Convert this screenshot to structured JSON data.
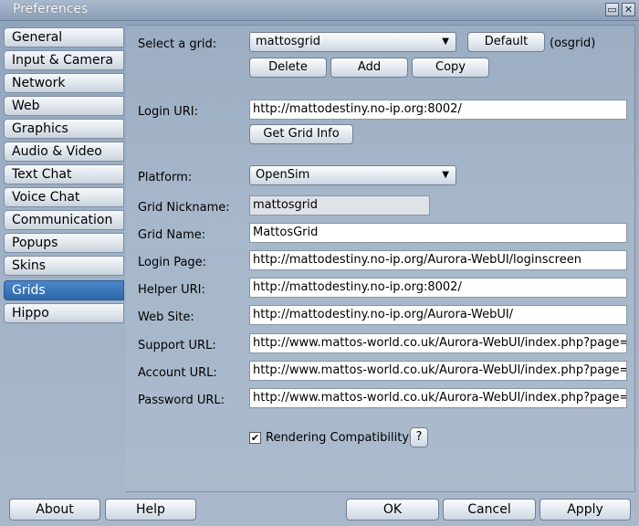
{
  "window": {
    "title": "Preferences",
    "minimize_icon": "▭",
    "close_icon": "✕"
  },
  "tabs": [
    {
      "label": "General"
    },
    {
      "label": "Input & Camera"
    },
    {
      "label": "Network"
    },
    {
      "label": "Web"
    },
    {
      "label": "Graphics"
    },
    {
      "label": "Audio & Video"
    },
    {
      "label": "Text Chat"
    },
    {
      "label": "Voice Chat"
    },
    {
      "label": "Communication"
    },
    {
      "label": "Popups"
    },
    {
      "label": "Skins"
    },
    {
      "label": "Grids",
      "active": true
    },
    {
      "label": "Hippo"
    }
  ],
  "grids": {
    "select_label": "Select a grid:",
    "selected_grid": "mattosgrid",
    "default_button": "Default",
    "default_grid": "(osgrid)",
    "delete_button": "Delete",
    "add_button": "Add",
    "copy_button": "Copy",
    "login_uri_label": "Login URI:",
    "login_uri": "http://mattodestiny.no-ip.org:8002/",
    "get_grid_info_button": "Get Grid Info",
    "platform_label": "Platform:",
    "platform": "OpenSim",
    "grid_nickname_label": "Grid Nickname:",
    "grid_nickname": "mattosgrid",
    "grid_name_label": "Grid Name:",
    "grid_name": "MattosGrid",
    "login_page_label": "Login Page:",
    "login_page": "http://mattodestiny.no-ip.org/Aurora-WebUI/loginscreen",
    "helper_uri_label": "Helper URI:",
    "helper_uri": "http://mattodestiny.no-ip.org:8002/",
    "web_site_label": "Web Site:",
    "web_site": "http://mattodestiny.no-ip.org/Aurora-WebUI/",
    "support_url_label": "Support URL:",
    "support_url": "http://www.mattos-world.co.uk/Aurora-WebUI/index.php?page=help",
    "account_url_label": "Account URL:",
    "account_url": "http://www.mattos-world.co.uk/Aurora-WebUI/index.php?page=regis",
    "password_url_label": "Password URL:",
    "password_url": "http://www.mattos-world.co.uk/Aurora-WebUI/index.php?page=login",
    "rendering_compat_label": "Rendering Compatibility",
    "rendering_compat_checked": true,
    "check_mark": "✔",
    "help_button": "?"
  },
  "footer": {
    "about": "About",
    "help": "Help",
    "ok": "OK",
    "cancel": "Cancel",
    "apply": "Apply"
  }
}
